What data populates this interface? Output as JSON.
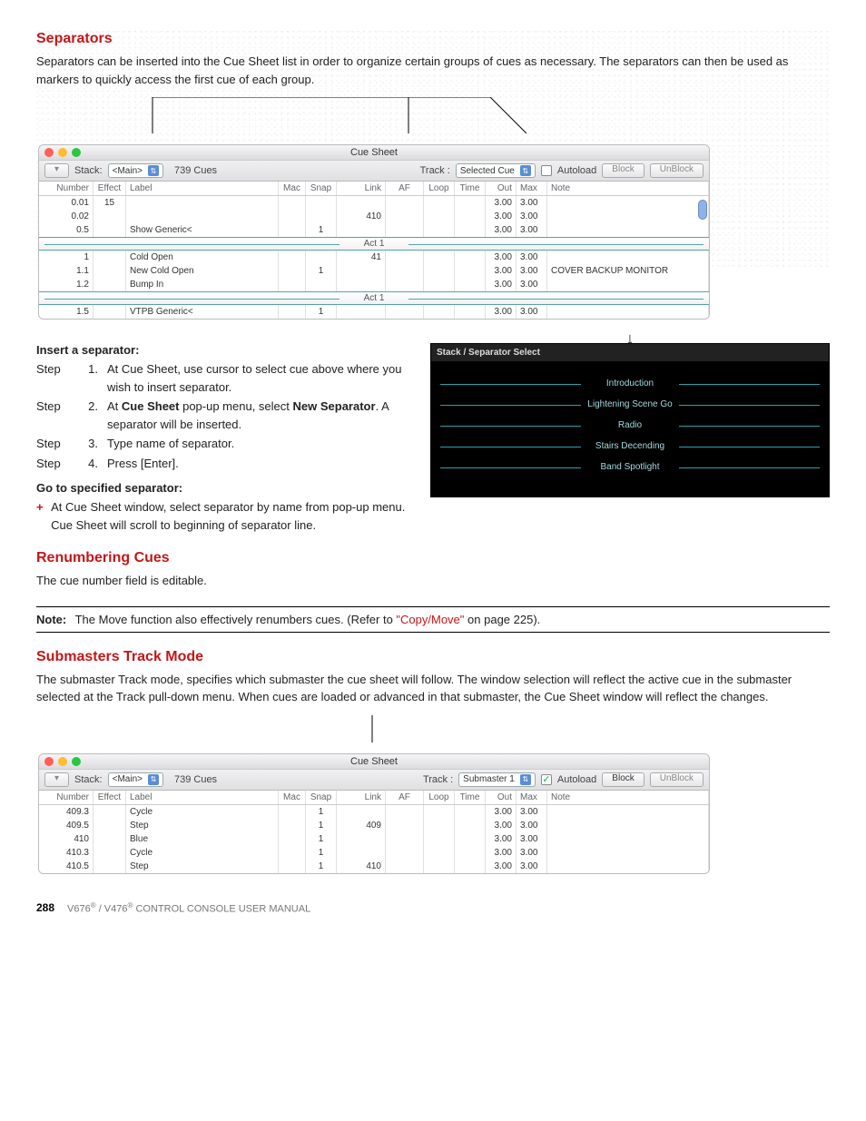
{
  "section1": {
    "title": "Separators",
    "para": "Separators can be inserted into the Cue Sheet list in order to organize certain groups of cues as necessary. The separators can then be used as markers to quickly access the first cue of each group."
  },
  "cue1": {
    "title": "Cue Sheet",
    "toolbar": {
      "stack_label": "Stack:",
      "stack_value": "<Main>",
      "cue_count": "739 Cues",
      "track_label": "Track :",
      "track_value": "Selected Cue",
      "autoload_label": "Autoload",
      "autoload_checked": false,
      "block_label": "Block",
      "unblock_label": "UnBlock"
    },
    "columns": [
      "Number",
      "Effect",
      "Label",
      "Mac",
      "Snap",
      "Link",
      "AF",
      "Loop",
      "Time",
      "Out",
      "Max",
      "Note"
    ],
    "rows": [
      {
        "num": "0.01",
        "eff": "15",
        "lbl": "",
        "mac": "",
        "snap": "",
        "link": "",
        "af": "",
        "loop": "",
        "time": "",
        "out": "3.00",
        "max": "3.00",
        "note": ""
      },
      {
        "num": "0.02",
        "eff": "",
        "lbl": "",
        "mac": "",
        "snap": "",
        "link": "410",
        "af": "",
        "loop": "",
        "time": "",
        "out": "3.00",
        "max": "3.00",
        "note": ""
      },
      {
        "num": "0.5",
        "eff": "",
        "lbl": "Show Generic<",
        "mac": "",
        "snap": "1",
        "link": "",
        "af": "",
        "loop": "",
        "time": "",
        "out": "3.00",
        "max": "3.00",
        "note": ""
      }
    ],
    "sep1": "Act 1",
    "rows_b": [
      {
        "num": "1",
        "eff": "",
        "lbl": "Cold Open",
        "mac": "",
        "snap": "",
        "link": "41",
        "af": "",
        "loop": "",
        "time": "",
        "out": "3.00",
        "max": "3.00",
        "note": ""
      },
      {
        "num": "1.1",
        "eff": "",
        "lbl": "New Cold Open",
        "mac": "",
        "snap": "1",
        "link": "",
        "af": "",
        "loop": "",
        "time": "",
        "out": "3.00",
        "max": "3.00",
        "note": "COVER BACKUP MONITOR"
      },
      {
        "num": "1.2",
        "eff": "",
        "lbl": "Bump In",
        "mac": "",
        "snap": "",
        "link": "",
        "af": "",
        "loop": "",
        "time": "",
        "out": "3.00",
        "max": "3.00",
        "note": ""
      }
    ],
    "sep2": "Act 1",
    "rows_c": [
      {
        "num": "1.5",
        "eff": "",
        "lbl": "VTPB Generic<",
        "mac": "",
        "snap": "1",
        "link": "",
        "af": "",
        "loop": "",
        "time": "",
        "out": "3.00",
        "max": "3.00",
        "note": ""
      }
    ]
  },
  "insert": {
    "heading": "Insert a separator:",
    "step_prefix": "Step",
    "steps": [
      {
        "n": "1.",
        "html": "At Cue Sheet, use cursor to select cue above where you wish to insert separator."
      },
      {
        "n": "2.",
        "html": "At <b>Cue Sheet</b> pop-up menu, select <b>New Separator</b>. A separator will be inserted."
      },
      {
        "n": "3.",
        "html": "Type name of separator."
      },
      {
        "n": "4.",
        "html": "Press [Enter]."
      }
    ],
    "goto_heading": "Go to specified separator:",
    "goto_text": "At Cue Sheet window, select separator by name from pop-up menu. Cue Sheet will scroll to beginning of separator line."
  },
  "dark": {
    "title": "Stack / Separator Select",
    "items": [
      "Introduction",
      "Lightening Scene Go",
      "Radio",
      "Stairs Decending",
      "Band Spotlight"
    ]
  },
  "section2": {
    "title": "Renumbering Cues",
    "para": "The cue number field is editable."
  },
  "note": {
    "label": "Note:",
    "text_a": "The Move function also effectively renumbers cues. (Refer to ",
    "link": "\"Copy/Move\"",
    "text_b": " on page 225)."
  },
  "section3": {
    "title": "Submasters Track Mode",
    "para": "The submaster Track mode, specifies which submaster the cue sheet will follow. The window selection will reflect the active cue in the submaster selected at the Track pull-down menu. When cues are loaded or advanced in that submaster, the Cue Sheet window will reflect the changes."
  },
  "cue2": {
    "title": "Cue Sheet",
    "toolbar": {
      "stack_label": "Stack:",
      "stack_value": "<Main>",
      "cue_count": "739 Cues",
      "track_label": "Track :",
      "track_value": "Submaster 1",
      "autoload_label": "Autoload",
      "autoload_checked": true,
      "block_label": "Block",
      "unblock_label": "UnBlock"
    },
    "columns": [
      "Number",
      "Effect",
      "Label",
      "Mac",
      "Snap",
      "Link",
      "AF",
      "Loop",
      "Time",
      "Out",
      "Max",
      "Note"
    ],
    "rows": [
      {
        "num": "409.3",
        "eff": "",
        "lbl": "Cycle",
        "mac": "",
        "snap": "1",
        "link": "",
        "af": "",
        "loop": "",
        "time": "",
        "out": "3.00",
        "max": "3.00",
        "note": ""
      },
      {
        "num": "409.5",
        "eff": "",
        "lbl": "Step",
        "mac": "",
        "snap": "1",
        "link": "409",
        "af": "",
        "loop": "",
        "time": "",
        "out": "3.00",
        "max": "3.00",
        "note": ""
      },
      {
        "num": "410",
        "eff": "",
        "lbl": "Blue",
        "mac": "",
        "snap": "1",
        "link": "",
        "af": "",
        "loop": "",
        "time": "",
        "out": "3.00",
        "max": "3.00",
        "note": ""
      },
      {
        "num": "410.3",
        "eff": "",
        "lbl": "Cycle",
        "mac": "",
        "snap": "1",
        "link": "",
        "af": "",
        "loop": "",
        "time": "",
        "out": "3.00",
        "max": "3.00",
        "note": ""
      },
      {
        "num": "410.5",
        "eff": "",
        "lbl": "Step",
        "mac": "",
        "snap": "1",
        "link": "410",
        "af": "",
        "loop": "",
        "time": "",
        "out": "3.00",
        "max": "3.00",
        "note": ""
      }
    ]
  },
  "footer": {
    "page": "288",
    "book": "V676® / V476® CONTROL CONSOLE USER MANUAL"
  }
}
